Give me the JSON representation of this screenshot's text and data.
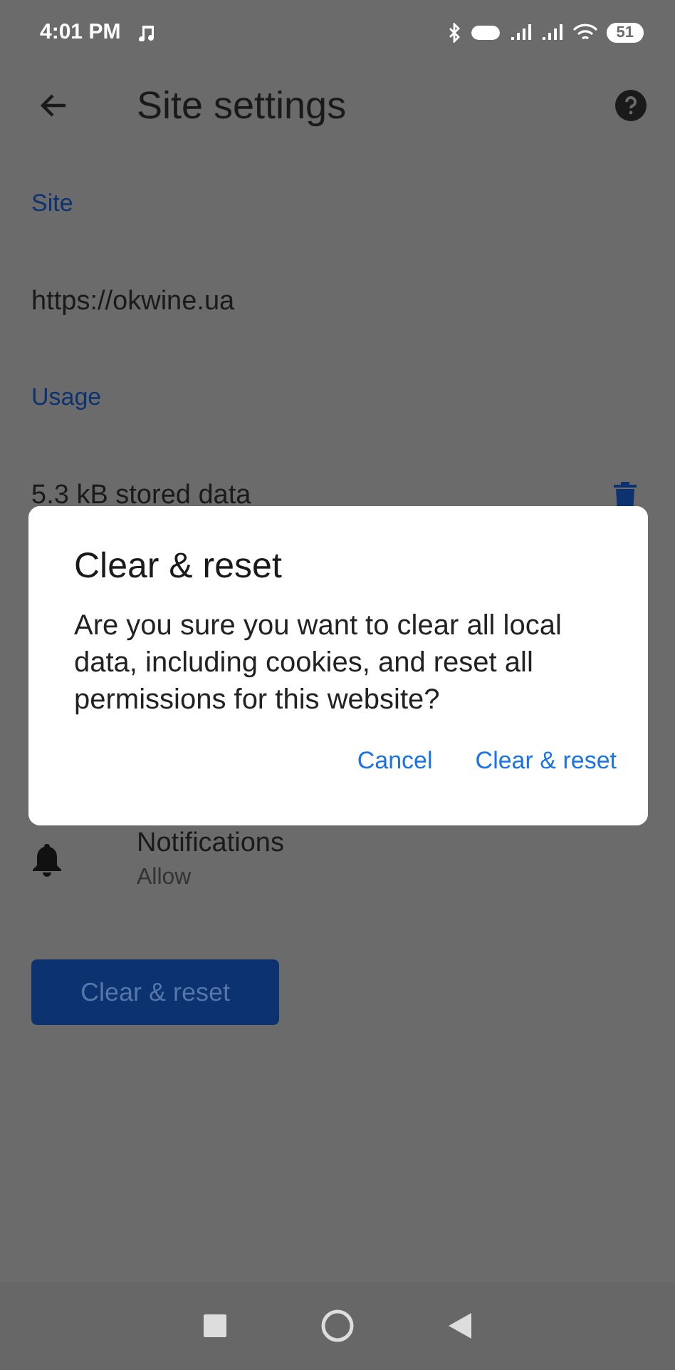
{
  "status_bar": {
    "time": "4:01 PM",
    "battery": "51"
  },
  "toolbar": {
    "title": "Site settings"
  },
  "sections": [
    {
      "header": "Site",
      "text": "https://okwine.ua"
    },
    {
      "header": "Usage",
      "text": "5.3 kB stored data"
    }
  ],
  "permission": {
    "title": "Notifications",
    "value": "Allow"
  },
  "clear_button": {
    "label": "Clear & reset"
  },
  "dialog": {
    "title": "Clear & reset",
    "message": "Are you sure you want to clear all local data, including cookies, and reset all permissions for this website?",
    "buttons": [
      "Cancel",
      "Clear & reset"
    ]
  }
}
